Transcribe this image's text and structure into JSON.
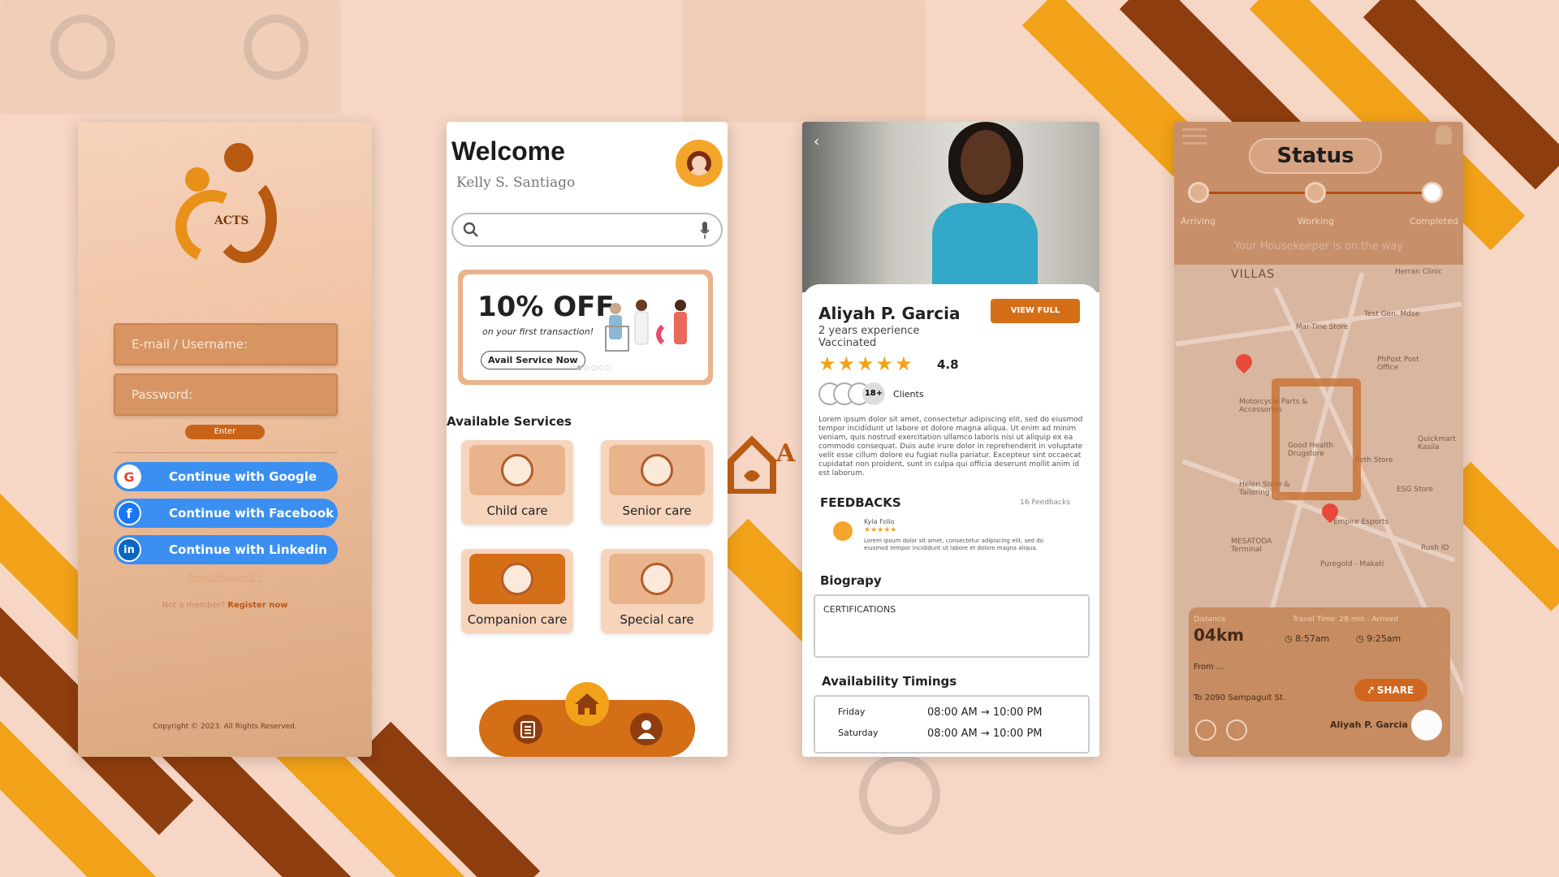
{
  "colors": {
    "orange": "#f2a218",
    "brown": "#8e3d0f",
    "accent": "#d46f18",
    "bg": "#f6d6c4"
  },
  "login": {
    "logo_text": "ACTS",
    "email_placeholder": "E-mail / Username:",
    "password_placeholder": "Password:",
    "enter_label": "Enter",
    "google_label": "Continue with Google",
    "facebook_label": "Continue with Facebook",
    "linkedin_label": "Continue with Linkedin",
    "forgot_label": "Forgot Password ?",
    "not_member_label": "Not a member?",
    "register_label": "Register now",
    "copyright": "Copyright © 2023. All Rights Reserved."
  },
  "home": {
    "title": "Welcome",
    "user_name": "Kelly S. Santiago",
    "search_icon": "search-icon",
    "mic_icon": "mic-icon",
    "promo": {
      "headline": "10% OFF",
      "subtitle": "on your first transaction!",
      "button": "Avail Service Now"
    },
    "section_title": "Available Services",
    "services": [
      {
        "label": "Child care"
      },
      {
        "label": "Senior care"
      },
      {
        "label": "Companion care"
      },
      {
        "label": "Special care"
      }
    ]
  },
  "profile": {
    "name": "Aliyah P. Garcia",
    "view_full_profile": "VIEW FULL PROFILE",
    "experience": "2 years experience",
    "vaccinated": "Vaccinated",
    "stars": "★★★★★",
    "rating": "4.8",
    "clients_count": "18+",
    "clients_label": "Clients",
    "about": "Lorem ipsum dolor sit amet, consectetur adipiscing elit, sed do eiusmod tempor incididunt ut labore et dolore magna aliqua. Ut enim ad minim veniam, quis nostrud exercitation ullamco laboris nisi ut aliquip ex ea commodo consequat. Duis aute irure dolor in reprehenderit in voluptate velit esse cillum dolore eu fugiat nulla pariatur. Excepteur sint occaecat cupidatat non proident, sunt in culpa qui officia deserunt mollit anim id est laborum.",
    "feedbacks_title": "FEEDBACKS",
    "feedbacks_count": "16 Feedbacks",
    "feedback": {
      "name": "Kyla Folio",
      "stars": "★★★★★",
      "text": "Lorem ipsum dolor sit amet, consectetur adipiscing elit, sed do eiusmod tempor incididunt ut labore et dolore magna aliqua."
    },
    "biography_title": "Biograpy",
    "certifications": "CERTIFICATIONS",
    "availability_title": "Availability Timings",
    "timings": [
      {
        "day": "Friday",
        "time": "08:00 AM → 10:00 PM"
      },
      {
        "day": "Saturday",
        "time": "08:00 AM → 10:00 PM"
      }
    ]
  },
  "status": {
    "title": "Status",
    "steps": [
      "Arriving",
      "Working",
      "Completed"
    ],
    "message": "Your Housekeeper is on the way",
    "map_labels": [
      "VILLAS",
      "Herran Clinic",
      "Test Gen. Mdse",
      "Mar-Tine Store",
      "PhPost Post Office",
      "Motorcycle Parts & Accessories",
      "Good Health Drugstore",
      "Beth Store",
      "Quickmart Kasila",
      "Helen Store & Tailoring",
      "Empire Esports",
      "ESG Store",
      "MESATODA Terminal",
      "Puregold - Makati",
      "Rush ID"
    ],
    "distance_label": "Distance",
    "distance": "04km",
    "travel_label": "Travel Time: 28 min · Arrived",
    "time_start": "8:57am",
    "time_end": "9:25am",
    "from_label": "From ...",
    "to_label": "To 2090 Sampaguit St.",
    "share_label": "SHARE",
    "caregiver": "Aliyah P. Garcia"
  }
}
